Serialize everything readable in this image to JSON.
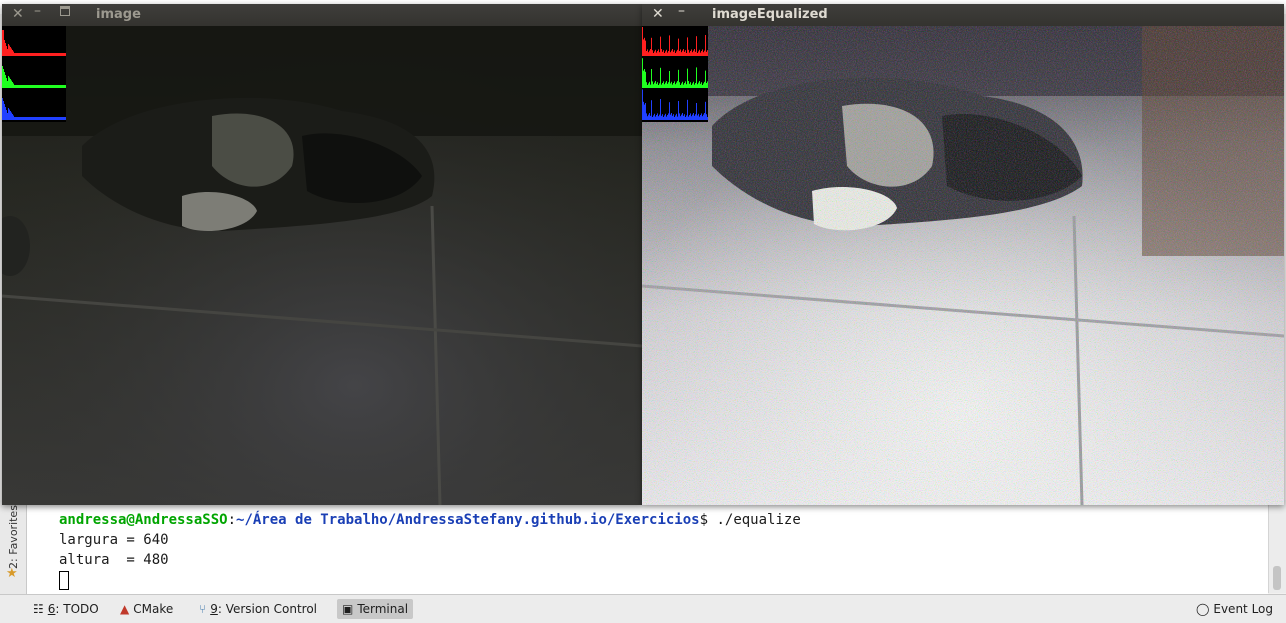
{
  "windows": [
    {
      "title": "image",
      "icons": [
        "close-icon",
        "minimize-icon",
        "maximize-icon"
      ]
    },
    {
      "title": "imageEqualized",
      "icons": [
        "close-icon",
        "minimize-icon"
      ]
    }
  ],
  "sidebar": {
    "favorites_label": "2: Favorites"
  },
  "terminal": {
    "prompt_user": "andressa@AndressaSSO",
    "prompt_sep": ":",
    "prompt_path": "~/Área de Trabalho/AndressaStefany.github.io/Exercicios",
    "prompt_end": "$ ./equalize",
    "lines": [
      "largura = 640",
      "altura  = 480"
    ]
  },
  "toolbar": {
    "todo": {
      "mnemonic": "6",
      "label": ": TODO"
    },
    "cmake": {
      "label": "CMake"
    },
    "version_control": {
      "mnemonic": "9",
      "label": ": Version Control"
    },
    "terminal": {
      "label": "Terminal"
    },
    "event_log": {
      "label": "Event Log"
    }
  },
  "colors": {
    "prompt_user": "#00a500",
    "prompt_path": "#1a3fb5",
    "hist_red": "#ff2020",
    "hist_green": "#20ff20",
    "hist_blue": "#2040ff"
  }
}
